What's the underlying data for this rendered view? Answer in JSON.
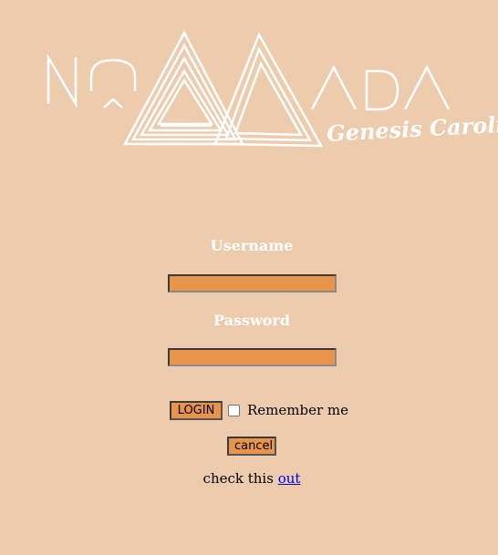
{
  "logo": {
    "text": "NOMADA",
    "signature": "Genesis Carolina",
    "color": "#ffffff"
  },
  "form": {
    "username_label": "Username",
    "username_value": "",
    "password_label": "Password",
    "password_value": "",
    "login_label": "LOGIN",
    "remember_label": "Remember me",
    "remember_checked": false,
    "cancel_label": "cancel"
  },
  "footer": {
    "prefix": "check this ",
    "link_text": "out"
  },
  "colors": {
    "background": "#edcbad",
    "input_fill": "#e8944a",
    "label_text": "#ffffff",
    "link": "#0000ee"
  }
}
